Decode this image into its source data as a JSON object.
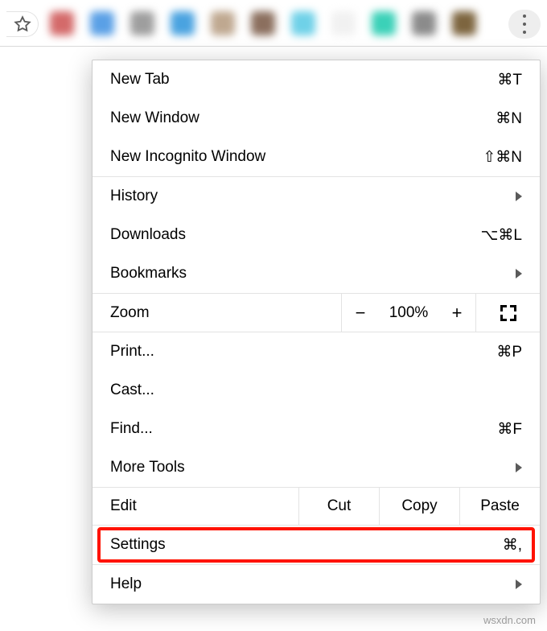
{
  "toolbar": {
    "extension_colors": [
      "#d46a6a",
      "#5aa0e6",
      "#9e9e9e",
      "#4aa3e0",
      "#bfa890",
      "#8b6f5e",
      "#6fd1e8",
      "#f1f1f1",
      "#3bd1b8",
      "#8b8b8b",
      "#7d653f"
    ]
  },
  "menu": {
    "new_tab": {
      "label": "New Tab",
      "shortcut": "⌘T"
    },
    "new_window": {
      "label": "New Window",
      "shortcut": "⌘N"
    },
    "new_incognito": {
      "label": "New Incognito Window",
      "shortcut": "⇧⌘N"
    },
    "history": {
      "label": "History"
    },
    "downloads": {
      "label": "Downloads",
      "shortcut": "⌥⌘L"
    },
    "bookmarks": {
      "label": "Bookmarks"
    },
    "zoom": {
      "label": "Zoom",
      "minus": "−",
      "pct": "100%",
      "plus": "+"
    },
    "print": {
      "label": "Print...",
      "shortcut": "⌘P"
    },
    "cast": {
      "label": "Cast..."
    },
    "find": {
      "label": "Find...",
      "shortcut": "⌘F"
    },
    "more_tools": {
      "label": "More Tools"
    },
    "edit": {
      "label": "Edit",
      "cut": "Cut",
      "copy": "Copy",
      "paste": "Paste"
    },
    "settings": {
      "label": "Settings",
      "shortcut": "⌘,"
    },
    "help": {
      "label": "Help"
    }
  },
  "watermark": "wsxdn.com"
}
